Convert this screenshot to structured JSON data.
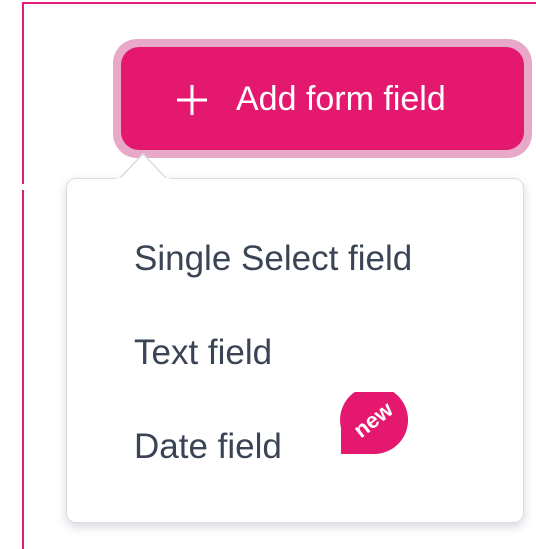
{
  "add_button": {
    "label": "Add form field",
    "icon": "plus-icon",
    "color": "#e4186f",
    "halo_color": "#e7a9c7"
  },
  "menu": {
    "items": [
      {
        "label": "Single Select field"
      },
      {
        "label": "Text field"
      },
      {
        "label": "Date field"
      }
    ],
    "text_color": "#3a4455"
  },
  "badge": {
    "text": "new",
    "color": "#e4186f"
  },
  "frame_color": "#e01b78"
}
